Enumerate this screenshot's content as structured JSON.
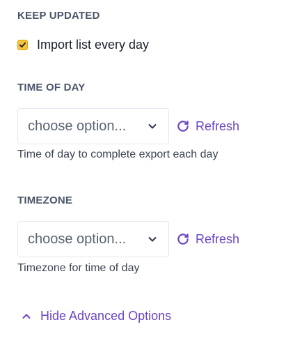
{
  "keep_updated": {
    "heading": "KEEP UPDATED",
    "checkbox_label": "Import list every day",
    "checked": true
  },
  "time_of_day": {
    "heading": "TIME OF DAY",
    "select_value": "choose option...",
    "refresh_label": "Refresh",
    "help_text": "Time of day to complete export each day"
  },
  "timezone": {
    "heading": "TIMEZONE",
    "select_value": "choose option...",
    "refresh_label": "Refresh",
    "help_text": "Timezone for time of day"
  },
  "advanced": {
    "toggle_label": "Hide Advanced Options"
  },
  "icons": {
    "checkbox": "check-icon",
    "dropdown": "chevron-down-icon",
    "refresh": "refresh-icon",
    "advanced": "chevron-up-icon"
  },
  "colors": {
    "accent": "#6b46c1",
    "checkbox_fill": "#f6c343",
    "heading": "#4a5568"
  }
}
